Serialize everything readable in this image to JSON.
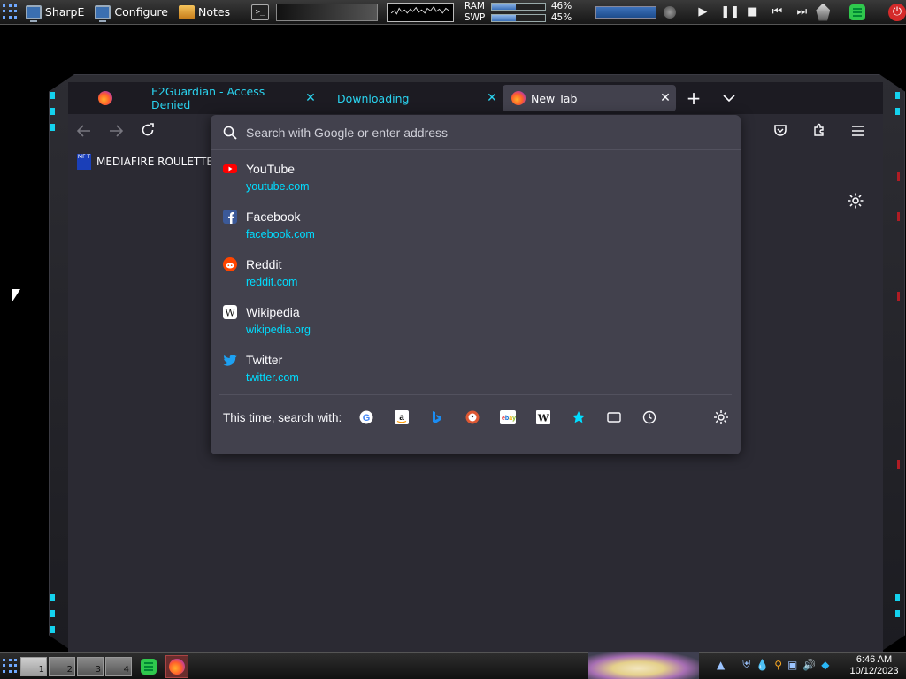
{
  "top_panel": {
    "launchers": [
      {
        "label": "SharpE",
        "icon": "monitor-icon"
      },
      {
        "label": "Configure",
        "icon": "monitor-icon"
      },
      {
        "label": "Notes",
        "icon": "notes-icon"
      }
    ],
    "ram_label": "RAM",
    "swp_label": "SWP",
    "ram_pct": "46%",
    "swp_pct": "45%",
    "ram_fraction": 0.46,
    "swp_fraction": 0.45
  },
  "tabs": [
    {
      "label": "E2Guardian - Access Denied",
      "close": "✕"
    },
    {
      "label": "Downloading",
      "close": "✕"
    },
    {
      "label": "New Tab",
      "close": "✕"
    }
  ],
  "new_tab_symbol": "+",
  "list_tabs_symbol": "⌄",
  "bookmark": {
    "label": "MEDIAFIRE ROULETTER",
    "icon_text": "MF T"
  },
  "url": {
    "placeholder": "Search with Google or enter address",
    "value": ""
  },
  "suggestions": [
    {
      "title": "YouTube",
      "url": "youtube.com",
      "icon": "youtube-icon",
      "color": "#ff0000"
    },
    {
      "title": "Facebook",
      "url": "facebook.com",
      "icon": "facebook-icon",
      "color": "#3b5998"
    },
    {
      "title": "Reddit",
      "url": "reddit.com",
      "icon": "reddit-icon",
      "color": "#ff4500"
    },
    {
      "title": "Wikipedia",
      "url": "wikipedia.org",
      "icon": "wikipedia-icon",
      "color": "#ffffff"
    },
    {
      "title": "Twitter",
      "url": "twitter.com",
      "icon": "twitter-icon",
      "color": "#1da1f2"
    }
  ],
  "one_off": {
    "label": "This time, search with:",
    "engines": [
      {
        "name": "google-icon",
        "glyph": "G",
        "color": "#4285f4"
      },
      {
        "name": "amazon-icon",
        "glyph": "a",
        "color": "#111"
      },
      {
        "name": "bing-icon",
        "glyph": "b",
        "color": "#1b8cf2"
      },
      {
        "name": "duckduckgo-icon",
        "glyph": "D",
        "color": "#de5833"
      },
      {
        "name": "ebay-icon",
        "glyph": "eb",
        "color": "#e53238"
      },
      {
        "name": "wikipedia-search-icon",
        "glyph": "W",
        "color": "#111"
      },
      {
        "name": "bookmarks-star-icon",
        "glyph": "★",
        "color": "#00ddff"
      },
      {
        "name": "tabs-icon",
        "glyph": "▭",
        "color": "#fbfbfe"
      },
      {
        "name": "history-icon",
        "glyph": "◷",
        "color": "#fbfbfe"
      }
    ]
  },
  "taskbar": {
    "workspaces": [
      "1",
      "2",
      "3",
      "4"
    ],
    "active_workspace": "1",
    "clock_time": "6:46 AM",
    "clock_date": "10/12/2023"
  },
  "colors": {
    "accent_cyan": "#00ddff",
    "tab_text_cyan": "#2ad3ef",
    "panel_bg": "#42414d",
    "toolbar_bg": "#2b2a33"
  }
}
